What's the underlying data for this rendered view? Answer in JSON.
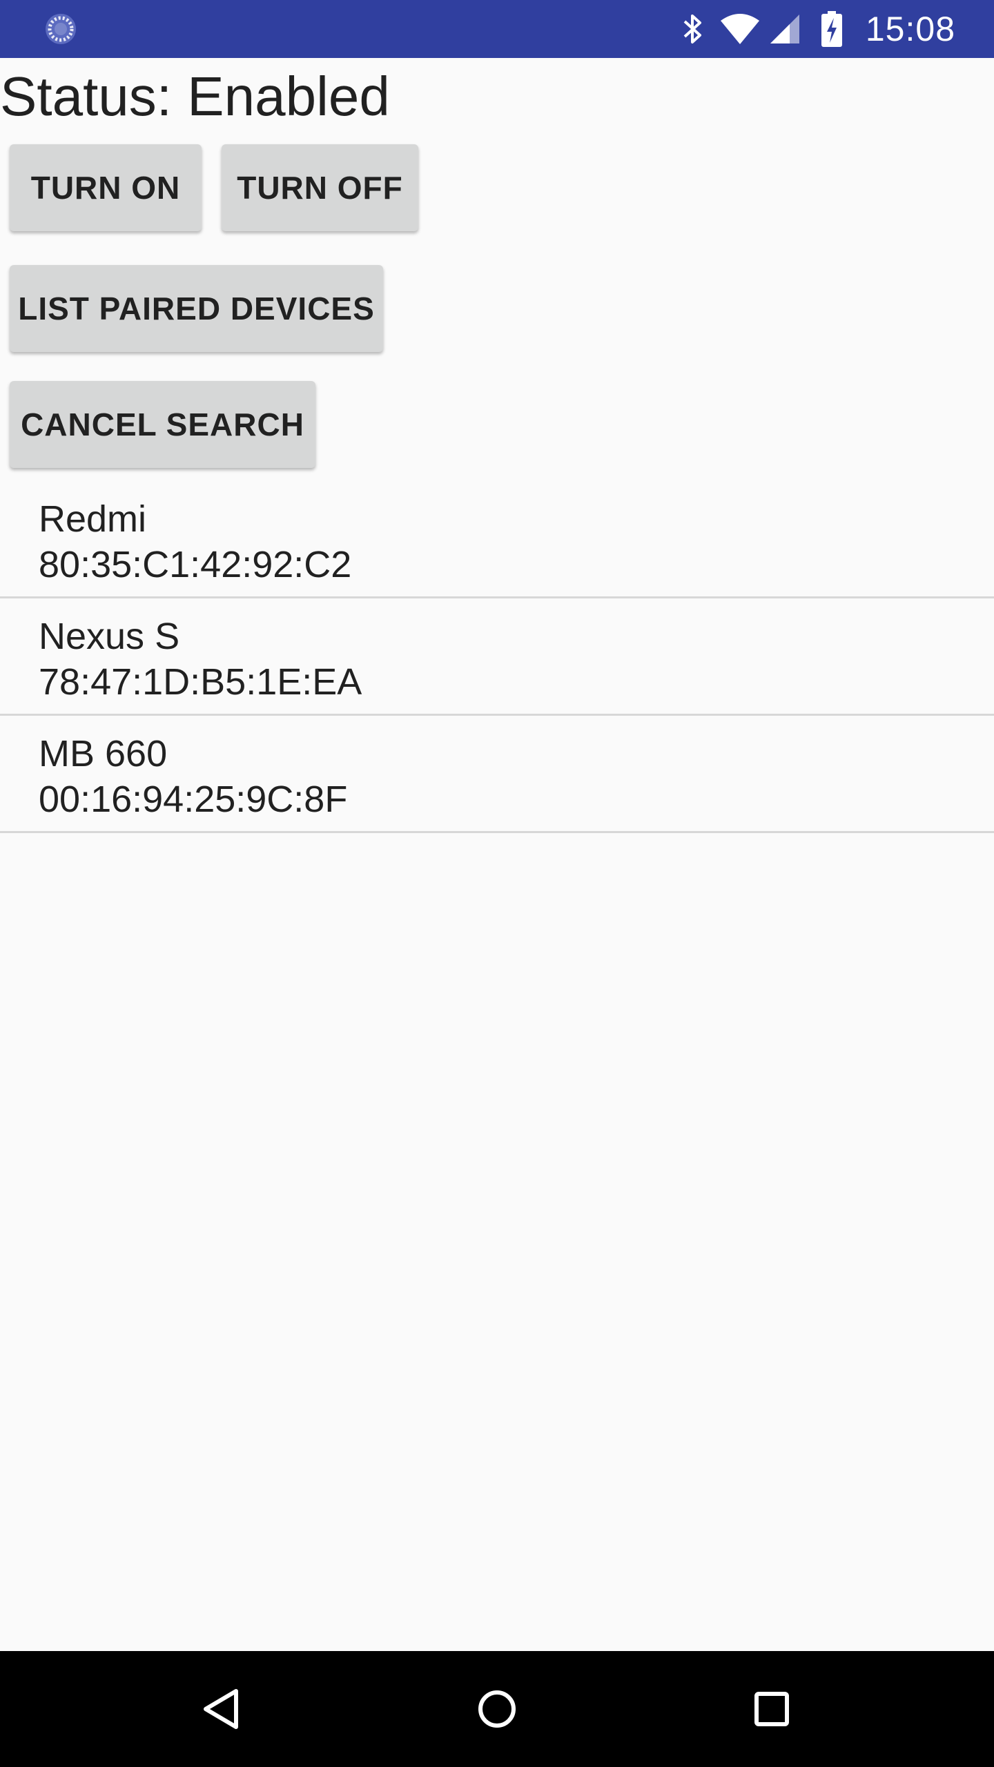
{
  "status_bar": {
    "time": "15:08",
    "left_icon": "sync-progress-icon",
    "icons": [
      "bluetooth-icon",
      "wifi-icon",
      "signal-icon",
      "battery-charging-icon"
    ]
  },
  "main": {
    "status_text": "Status: Enabled",
    "buttons": {
      "turn_on": "TURN ON",
      "turn_off": "TURN OFF",
      "list_paired": "LIST PAIRED DEVICES",
      "cancel_search": "CANCEL SEARCH"
    },
    "devices": [
      {
        "name": "Redmi",
        "address": "80:35:C1:42:92:C2"
      },
      {
        "name": "Nexus S",
        "address": "78:47:1D:B5:1E:EA"
      },
      {
        "name": "MB 660",
        "address": "00:16:94:25:9C:8F"
      }
    ]
  },
  "nav_bar": {
    "icons": [
      "back-icon",
      "home-icon",
      "recents-icon"
    ]
  },
  "colors": {
    "status_bar": "#303f9f",
    "background": "#fafafa",
    "button": "#d6d7d7",
    "divider": "#d7d7d7",
    "nav_bar": "#000000"
  }
}
